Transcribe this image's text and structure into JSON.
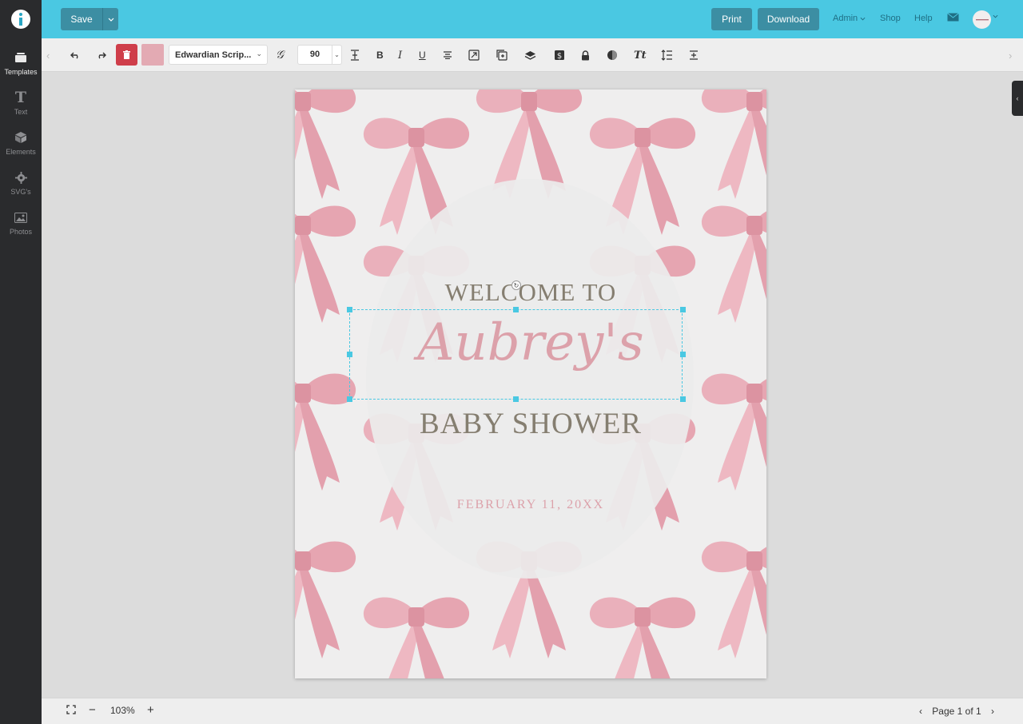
{
  "topbar": {
    "save_label": "Save",
    "print_label": "Print",
    "download_label": "Download",
    "admin_label": "Admin",
    "shop_label": "Shop",
    "help_label": "Help"
  },
  "sidebar": {
    "items": [
      {
        "label": "Templates",
        "icon": "templates-icon",
        "active": true
      },
      {
        "label": "Text",
        "icon": "text-icon"
      },
      {
        "label": "Elements",
        "icon": "elements-icon"
      },
      {
        "label": "SVG's",
        "icon": "svg-icon"
      },
      {
        "label": "Photos",
        "icon": "photos-icon"
      }
    ]
  },
  "toolbar": {
    "font_name": "Edwardian Scrip...",
    "font_size": "90",
    "color": "#e3aab3"
  },
  "design": {
    "welcome": "WELCOME TO",
    "name": "Aubrey's",
    "subtitle": "BABY SHOWER",
    "date": "FEBRUARY 11, 20XX"
  },
  "footer": {
    "zoom": "103%",
    "page_indicator": "Page 1 of 1"
  },
  "colors": {
    "topbar": "#4ac8e2",
    "button": "#3c8ea3",
    "delete": "#cf3e4a",
    "bow": "#e8a9b5",
    "title_text": "#857e70",
    "accent_text": "#dca1aa"
  }
}
